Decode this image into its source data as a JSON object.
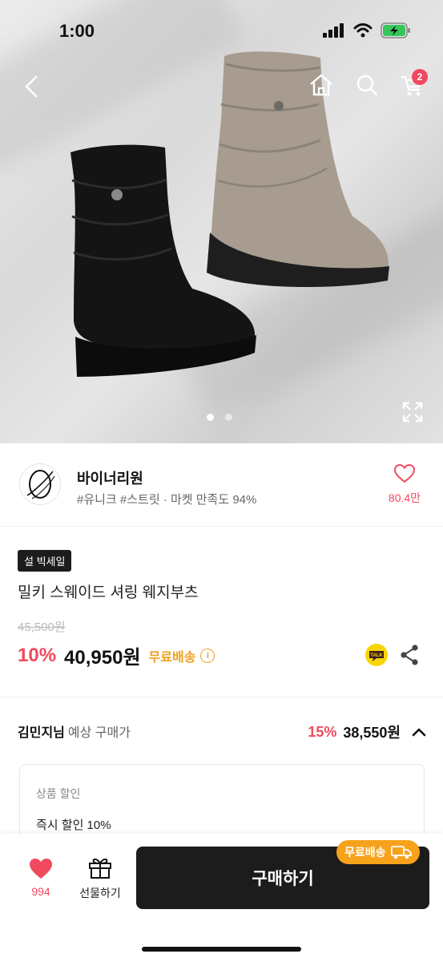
{
  "status_bar": {
    "time": "1:00",
    "icons": [
      "signal-icon",
      "wifi-icon",
      "battery-charging-icon"
    ]
  },
  "nav": {
    "cart_count": "2",
    "icons": [
      "back-arrow-icon",
      "home-icon",
      "search-icon",
      "cart-icon"
    ]
  },
  "gallery": {
    "current": 1,
    "total": 2
  },
  "shop": {
    "name": "바이너리원",
    "tags": "#유니크 #스트릿 · 마켓 만족도 94%",
    "likes": "80.4만"
  },
  "product": {
    "badge": "설 빅세일",
    "title": "밀키 스웨이드 셔링 웨지부츠",
    "original_price": "45,500원",
    "discount": "10%",
    "price": "40,950원",
    "shipping": "무료배송"
  },
  "expected": {
    "name": "김민지님",
    "label": "예상 구매가",
    "discount": "15%",
    "price": "38,550원"
  },
  "detail": {
    "heading": "상품 할인",
    "line": "즉시 할인 10%"
  },
  "bottom": {
    "wish_count": "994",
    "gift_label": "선물하기",
    "buy_label": "구매하기",
    "ship_pill": "무료배송"
  },
  "colors": {
    "accent": "#f04a5f",
    "shipping": "#f0a020",
    "button": "#1c1c1c"
  }
}
